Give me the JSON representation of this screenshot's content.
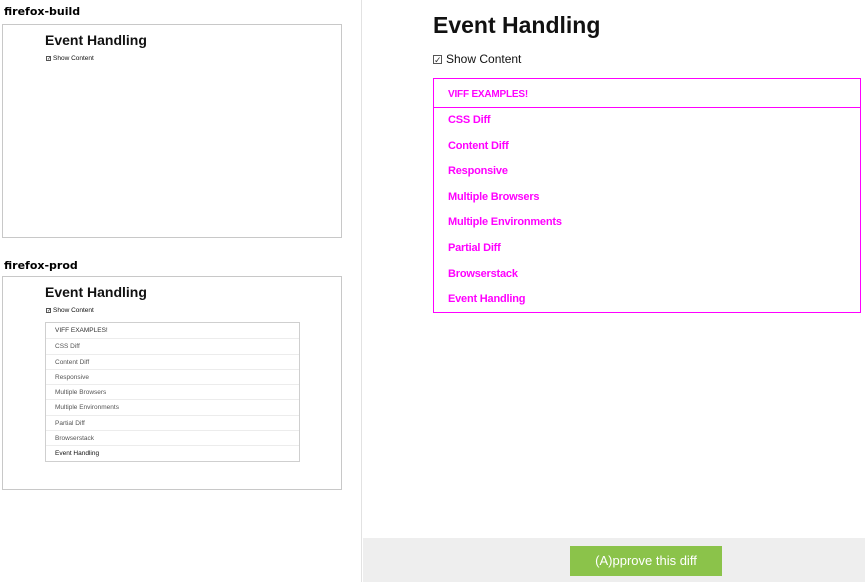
{
  "envs": [
    {
      "label": "firefox-build",
      "page": {
        "title": "Event Handling",
        "checkbox_label": "Show Content",
        "checked": true,
        "show_list": false
      }
    },
    {
      "label": "firefox-prod",
      "page": {
        "title": "Event Handling",
        "checkbox_label": "Show Content",
        "checked": true,
        "list": {
          "header": "VIFF EXAMPLES!",
          "items": [
            "CSS Diff",
            "Content Diff",
            "Responsive",
            "Multiple Browsers",
            "Multiple Environments",
            "Partial Diff",
            "Browserstack",
            "Event Handling"
          ]
        }
      }
    }
  ],
  "diff": {
    "title": "Event Handling",
    "checkbox_label": "Show Content",
    "checked": true,
    "highlight_color": "#ff00ff",
    "list": {
      "header": "VIFF EXAMPLES!",
      "items": [
        "CSS Diff",
        "Content Diff",
        "Responsive",
        "Multiple Browsers",
        "Multiple Environments",
        "Partial Diff",
        "Browserstack",
        "Event Handling"
      ]
    }
  },
  "approve_button": {
    "label": "(A)pprove this diff",
    "color": "#8bc34a"
  }
}
